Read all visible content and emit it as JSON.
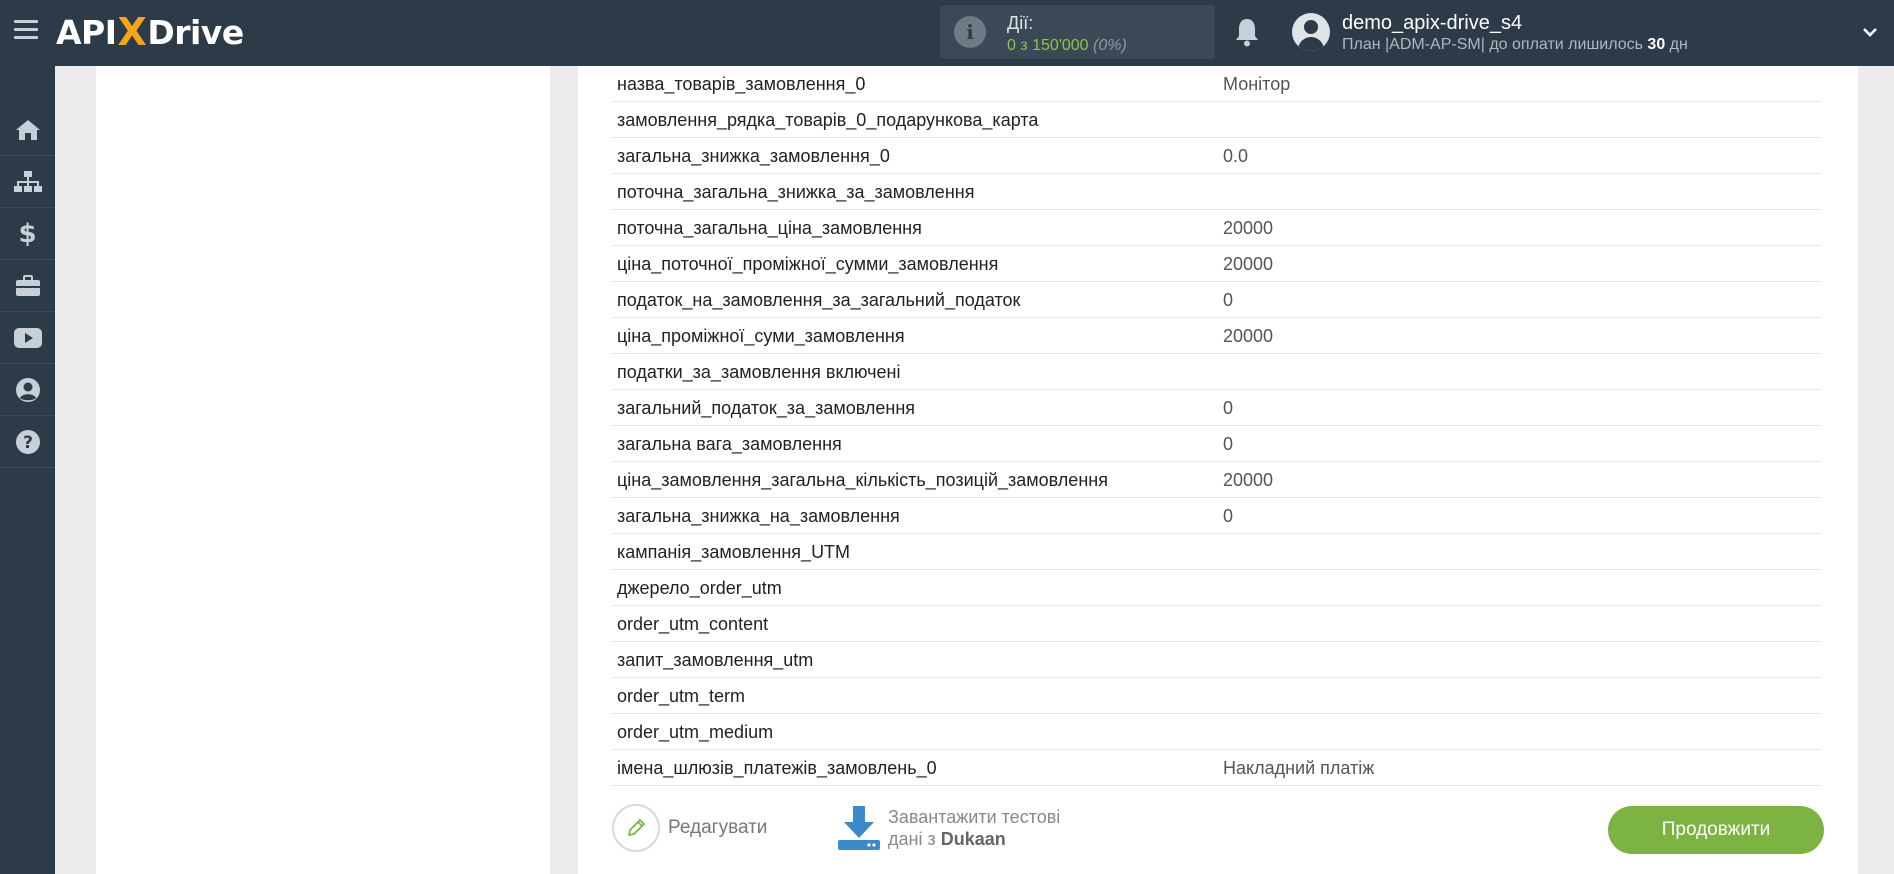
{
  "header": {
    "logo_left": "API",
    "logo_x": "X",
    "logo_right": "Drive",
    "actions_label": "Дії:",
    "actions_count": "0 з 150'000",
    "actions_percent": "(0%)",
    "user_name": "demo_apix-drive_s4",
    "plan_text": "План |ADM-AP-SM| до оплати лишилось",
    "plan_days": "30",
    "plan_days_unit": "дн"
  },
  "sidebar": {
    "items": [
      "home-icon",
      "sitemap-icon",
      "dollar-icon",
      "briefcase-icon",
      "youtube-icon",
      "user-circle-icon",
      "question-icon"
    ]
  },
  "rows": [
    {
      "key": "назва_товарів_замовлення_0",
      "value": "Монітор"
    },
    {
      "key": "замовлення_рядка_товарів_0_подарункова_карта",
      "value": ""
    },
    {
      "key": "загальна_знижка_замовлення_0",
      "value": "0.0"
    },
    {
      "key": "поточна_загальна_знижка_за_замовлення",
      "value": ""
    },
    {
      "key": "поточна_загальна_ціна_замовлення",
      "value": "20000"
    },
    {
      "key": "ціна_поточної_проміжної_сумми_замовлення",
      "value": "20000"
    },
    {
      "key": "податок_на_замовлення_за_загальний_податок",
      "value": "0"
    },
    {
      "key": "ціна_проміжної_суми_замовлення",
      "value": "20000"
    },
    {
      "key": "податки_за_замовлення включені",
      "value": ""
    },
    {
      "key": "загальний_податок_за_замовлення",
      "value": "0"
    },
    {
      "key": "загальна вага_замовлення",
      "value": "0"
    },
    {
      "key": "ціна_замовлення_загальна_кількість_позицій_замовлення",
      "value": "20000"
    },
    {
      "key": "загальна_знижка_на_замовлення",
      "value": "0"
    },
    {
      "key": "кампанія_замовлення_UTM",
      "value": ""
    },
    {
      "key": "джерело_order_utm",
      "value": ""
    },
    {
      "key": "order_utm_content",
      "value": ""
    },
    {
      "key": "запит_замовлення_utm",
      "value": ""
    },
    {
      "key": "order_utm_term",
      "value": ""
    },
    {
      "key": "order_utm_medium",
      "value": ""
    },
    {
      "key": "імена_шлюзів_платежів_замовлень_0",
      "value": "Накладний платіж"
    }
  ],
  "buttons": {
    "edit_label": "Редагувати",
    "download_line1": "Завантажити тестові",
    "download_line2": "дані з",
    "download_service": "Dukaan",
    "continue_label": "Продовжити"
  },
  "colors": {
    "topbar": "#2d3a47",
    "accent_green": "#7cb342",
    "logo_x": "#f6a51b",
    "download_blue": "#3b8bcb"
  }
}
